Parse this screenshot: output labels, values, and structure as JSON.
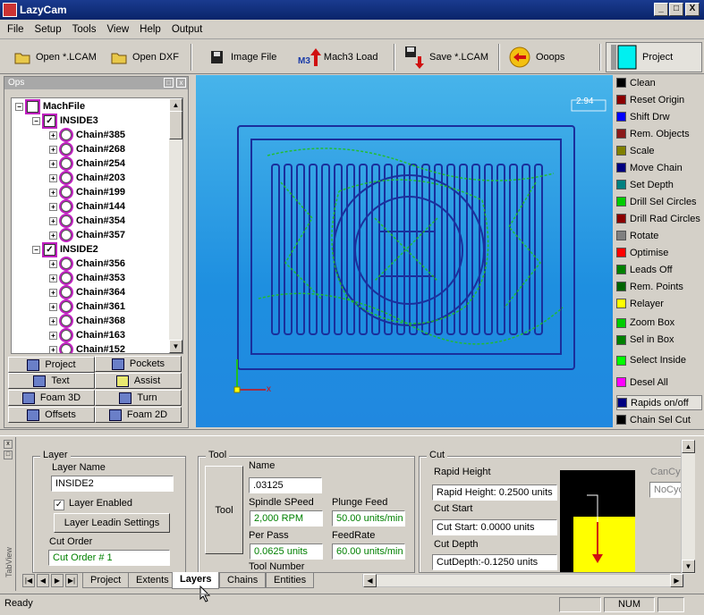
{
  "window": {
    "title": "LazyCam",
    "min": "_",
    "max": "□",
    "close": "X"
  },
  "menu": [
    "File",
    "Setup",
    "Tools",
    "View",
    "Help",
    "Output"
  ],
  "toolbar": {
    "open_lcam": "Open *.LCAM",
    "open_dxf": "Open DXF",
    "image_file": "Image File",
    "mach3_load": "Mach3 Load",
    "mach3_tag": "M3",
    "save_lcam": "Save *.LCAM",
    "ooops": "Ooops",
    "project": "Project"
  },
  "ops": {
    "title": "Ops",
    "tree": [
      {
        "label": "MachFile",
        "level": 0
      },
      {
        "label": "INSIDE3",
        "level": 1
      },
      {
        "label": "Chain#385",
        "level": 2
      },
      {
        "label": "Chain#268",
        "level": 2
      },
      {
        "label": "Chain#254",
        "level": 2
      },
      {
        "label": "Chain#203",
        "level": 2
      },
      {
        "label": "Chain#199",
        "level": 2
      },
      {
        "label": "Chain#144",
        "level": 2
      },
      {
        "label": "Chain#354",
        "level": 2
      },
      {
        "label": "Chain#357",
        "level": 2
      },
      {
        "label": "INSIDE2",
        "level": 1
      },
      {
        "label": "Chain#356",
        "level": 2
      },
      {
        "label": "Chain#353",
        "level": 2
      },
      {
        "label": "Chain#364",
        "level": 2
      },
      {
        "label": "Chain#361",
        "level": 2
      },
      {
        "label": "Chain#368",
        "level": 2
      },
      {
        "label": "Chain#163",
        "level": 2
      },
      {
        "label": "Chain#152",
        "level": 2
      }
    ],
    "buttons": [
      "Project",
      "Pockets",
      "Text",
      "Assist",
      "Foam 3D",
      "Turn",
      "Offsets",
      "Foam 2D"
    ]
  },
  "canvas": {
    "zoom_label": "2.94",
    "axis_x": "x"
  },
  "right_actions": [
    {
      "label": "Clean",
      "color": "#000000"
    },
    {
      "label": "Reset Origin",
      "color": "#8b0000"
    },
    {
      "label": "Shift Drw",
      "color": "#0000ff"
    },
    {
      "label": "Rem. Objects",
      "color": "#8b1a1a"
    },
    {
      "label": "Scale",
      "color": "#808000"
    },
    {
      "label": "Move Chain",
      "color": "#000080"
    },
    {
      "label": "Set Depth",
      "color": "#008080"
    },
    {
      "label": "Drill Sel Circles",
      "color": "#00cc00"
    },
    {
      "label": "Drill Rad Circles",
      "color": "#8b0000"
    },
    {
      "label": "Rotate",
      "color": "#808080"
    },
    {
      "label": "Optimise",
      "color": "#ff0000"
    },
    {
      "label": "Leads Off",
      "color": "#008000"
    },
    {
      "label": "Rem. Points",
      "color": "#006400"
    },
    {
      "label": "Relayer",
      "color": "#ffff00"
    },
    {
      "label": "Zoom Box",
      "color": "#00cc00"
    },
    {
      "label": "Sel in Box",
      "color": "#008000"
    },
    {
      "label": "Select Inside",
      "color": "#00ff00"
    },
    {
      "label": "Desel All",
      "color": "#ff00ff"
    },
    {
      "label": "Rapids on/off",
      "color": "#000080"
    },
    {
      "label": "Chain Sel Cut",
      "color": "#000000"
    }
  ],
  "layer": {
    "group": "Layer",
    "name_label": "Layer Name",
    "name_value": "INSIDE2",
    "enabled_label": "Layer Enabled",
    "leadin_button": "Layer Leadin Settings",
    "cut_order_label": "Cut Order",
    "cut_order_value": "Cut Order # 1"
  },
  "tool": {
    "group": "Tool",
    "tool_button": "Tool",
    "name_label": "Name",
    "name_value": ".03125",
    "spindle_label": "Spindle SPeed",
    "spindle_value": "2,000 RPM",
    "plunge_label": "Plunge Feed",
    "plunge_value": "50.00 units/min",
    "perpass_label": "Per Pass",
    "perpass_value": "0.0625 units",
    "feedrate_label": "FeedRate",
    "feedrate_value": "60.00 units/min",
    "toolnum_label": "Tool Number"
  },
  "cut": {
    "group": "Cut",
    "rapid_label": "Rapid Height",
    "rapid_value": "Rapid Height: 0.2500 units",
    "start_label": "Cut Start",
    "start_value": "Cut Start: 0.0000 units",
    "depth_label": "Cut Depth",
    "depth_value": "CutDepth:-0.1250 units",
    "cancyc_label": "CanCyc",
    "cancyc_value": "NoCyc"
  },
  "tabs": [
    "Project",
    "Extents",
    "Layers",
    "Chains",
    "Entities"
  ],
  "active_tab": "Layers",
  "tabview_label": "TabView",
  "status": {
    "text": "Ready",
    "num": "NUM"
  }
}
